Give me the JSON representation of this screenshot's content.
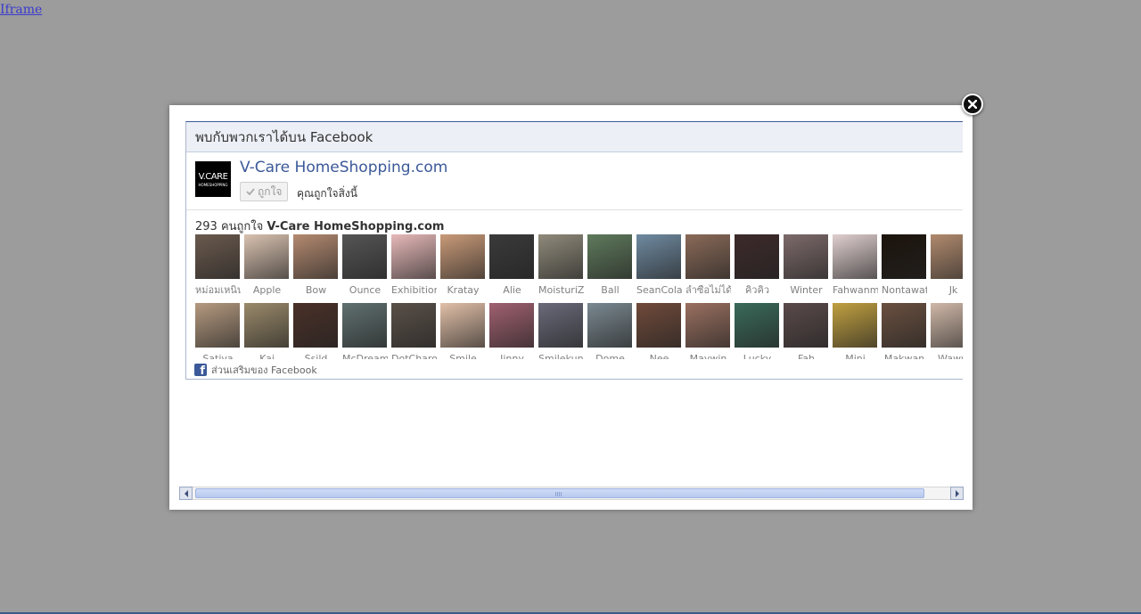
{
  "top_link": "Iframe",
  "modal": {
    "header_title": "พบกับพวกเราได้บน Facebook",
    "page_name": "V-Care HomeShopping.com",
    "logo": {
      "line1": "V.CARE",
      "line2": "HOMESHOPPING"
    },
    "like_button_label": "ถูกใจ",
    "like_status": "คุณถูกใจสิ่งนี้",
    "likes_count": "293",
    "likes_text": "คนถูกใจ",
    "likes_page": "V-Care HomeShopping.com",
    "footer_text": "ส่วนเสริมของ Facebook",
    "faces_row1": [
      {
        "name": "หม่อมเหนิน",
        "color": "#6b5a4e"
      },
      {
        "name": "Apple",
        "color": "#d9c2b0"
      },
      {
        "name": "Bow",
        "color": "#b48a70"
      },
      {
        "name": "Ounce",
        "color": "#555555"
      },
      {
        "name": "Exhibition",
        "color": "#e7b9b9"
      },
      {
        "name": "Kratay",
        "color": "#c99a78"
      },
      {
        "name": "Alie",
        "color": "#3a3a3a"
      },
      {
        "name": "MoisturiZin",
        "color": "#8f8a7a"
      },
      {
        "name": "Ball",
        "color": "#5f7a5c"
      },
      {
        "name": "SeanColato",
        "color": "#6f8aa0"
      },
      {
        "name": "ลำซื่อไม่ได้",
        "color": "#8a6a58"
      },
      {
        "name": "คิวคิว",
        "color": "#3d2a2a"
      },
      {
        "name": "Winter",
        "color": "#7d6a6a"
      },
      {
        "name": "Fahwanmai",
        "color": "#e0cfcf"
      },
      {
        "name": "Nontawat",
        "color": "#1c140c"
      },
      {
        "name": "Jk",
        "color": "#b08a6e"
      }
    ],
    "faces_row2": [
      {
        "name": "Sativa",
        "color": "#b59a80"
      },
      {
        "name": "Kai",
        "color": "#9a8a6a"
      },
      {
        "name": "Ssild",
        "color": "#4a3028"
      },
      {
        "name": "McDream",
        "color": "#607070"
      },
      {
        "name": "DotCharo",
        "color": "#5a5048"
      },
      {
        "name": "Smile",
        "color": "#e2c0a8"
      },
      {
        "name": "Jinny",
        "color": "#a06070"
      },
      {
        "name": "Smilekung",
        "color": "#6a6a7a"
      },
      {
        "name": "Dome",
        "color": "#7a8890"
      },
      {
        "name": "Nee",
        "color": "#704a3a"
      },
      {
        "name": "Maywin",
        "color": "#9a7060"
      },
      {
        "name": "Lucky",
        "color": "#3a6a5a"
      },
      {
        "name": "Fah",
        "color": "#5a4a4a"
      },
      {
        "name": "Mini",
        "color": "#c0a040"
      },
      {
        "name": "Makwan",
        "color": "#6a5040"
      },
      {
        "name": "Waww",
        "color": "#d0b8a8"
      }
    ]
  },
  "colors": {
    "fb_blue": "#3b5998",
    "backdrop": "#9c9c9c"
  }
}
